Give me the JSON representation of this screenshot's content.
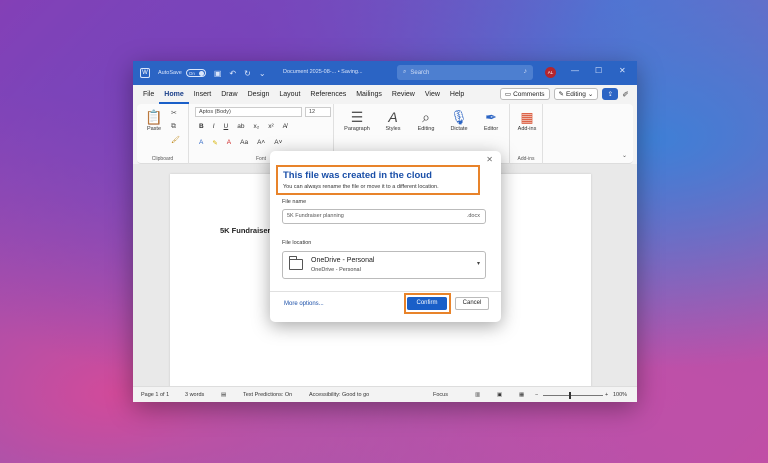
{
  "titlebar": {
    "app_icon": "word-icon",
    "autosave_label": "AutoSave",
    "autosave_state": "On",
    "doc_title": "Document 2025-08-... • Saving...",
    "search_placeholder": "Search",
    "user_initials": "AL",
    "minimize": "—",
    "maximize": "☐",
    "close": "✕"
  },
  "menu": {
    "tabs": [
      "File",
      "Home",
      "Insert",
      "Draw",
      "Design",
      "Layout",
      "References",
      "Mailings",
      "Review",
      "View",
      "Help"
    ],
    "active": "Home",
    "comments": "Comments",
    "editing": "Editing"
  },
  "ribbon": {
    "clipboard_label": "Clipboard",
    "paste": "Paste",
    "font_name": "Aptos (Body)",
    "font_size": "12",
    "font_label": "Font",
    "paragraph": "Paragraph",
    "styles": "Styles",
    "editing": "Editing",
    "dictate": "Dictate",
    "editor": "Editor",
    "addins": "Add-ins",
    "addins_group": "Add-ins"
  },
  "document": {
    "text": "5K Fundraiser"
  },
  "status": {
    "page": "Page 1 of 1",
    "words": "3 words",
    "predictions": "Text Predictions: On",
    "accessibility": "Accessibility: Good to go",
    "focus": "Focus",
    "zoom": "100%"
  },
  "dialog": {
    "title": "This file was created in the cloud",
    "subtitle": "You can always rename the file or move it to a different location.",
    "file_name_label": "File name",
    "file_name_value": "5K Fundraiser planning",
    "file_ext": ".docx",
    "location_label": "File location",
    "location_main": "OneDrive - Personal",
    "location_sub": "OneDrive - Personal",
    "more_options": "More options...",
    "confirm": "Confirm",
    "cancel": "Cancel"
  },
  "colors": {
    "accent": "#2b64c4",
    "highlight": "#e8832a"
  }
}
